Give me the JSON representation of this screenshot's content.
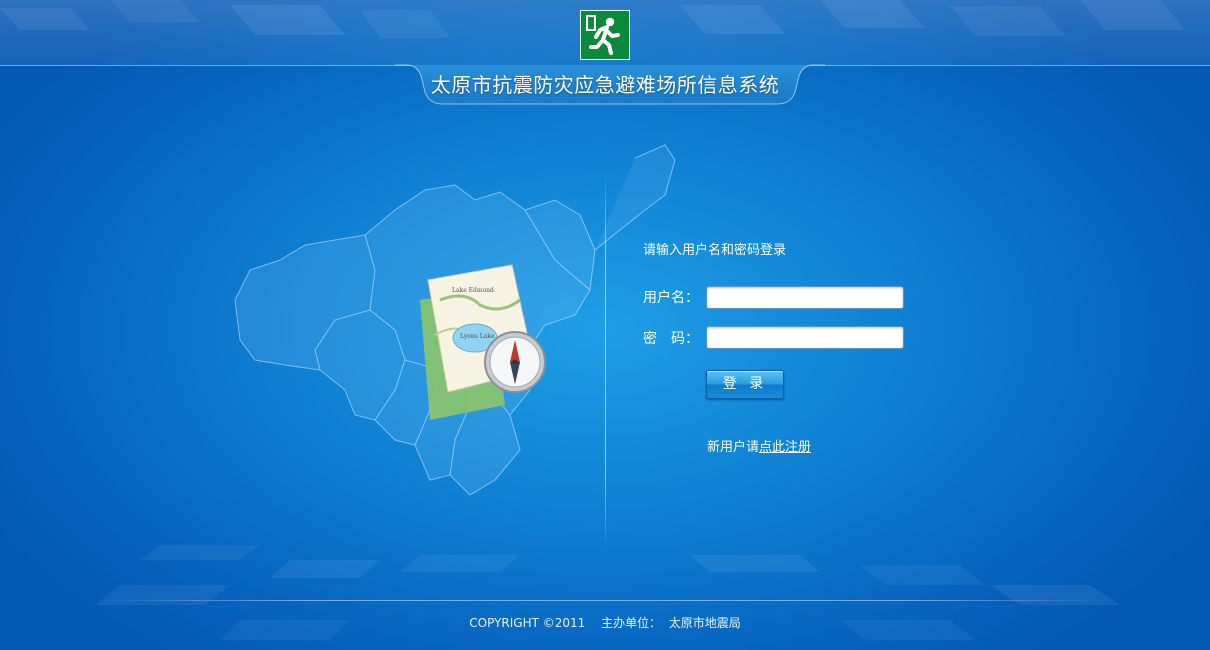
{
  "header": {
    "logo_icon": "emergency-exit-running-man-icon",
    "logo_color": "#0a8a3a",
    "title": "太原市抗震防灾应急避难场所信息系统"
  },
  "illustration": {
    "map_icon": "taiyuan-region-map",
    "map_card_icon": "map-with-compass-icon",
    "map_labels": [
      "Lake Edmond",
      "Lyons Lake"
    ]
  },
  "login": {
    "prompt": "请输入用户名和密码登录",
    "username_label": "用户名：",
    "username_value": "",
    "password_label": "密　码：",
    "password_value": "",
    "submit_label": "登 录",
    "register_prefix": "新用户请",
    "register_link": "点此注册"
  },
  "footer": {
    "copyright": "COPYRIGHT ©2011　 主办单位：  太原市地震局"
  },
  "colors": {
    "background_center": "#1e9fe6",
    "background_edge": "#0558b3",
    "button": "#2699de"
  }
}
